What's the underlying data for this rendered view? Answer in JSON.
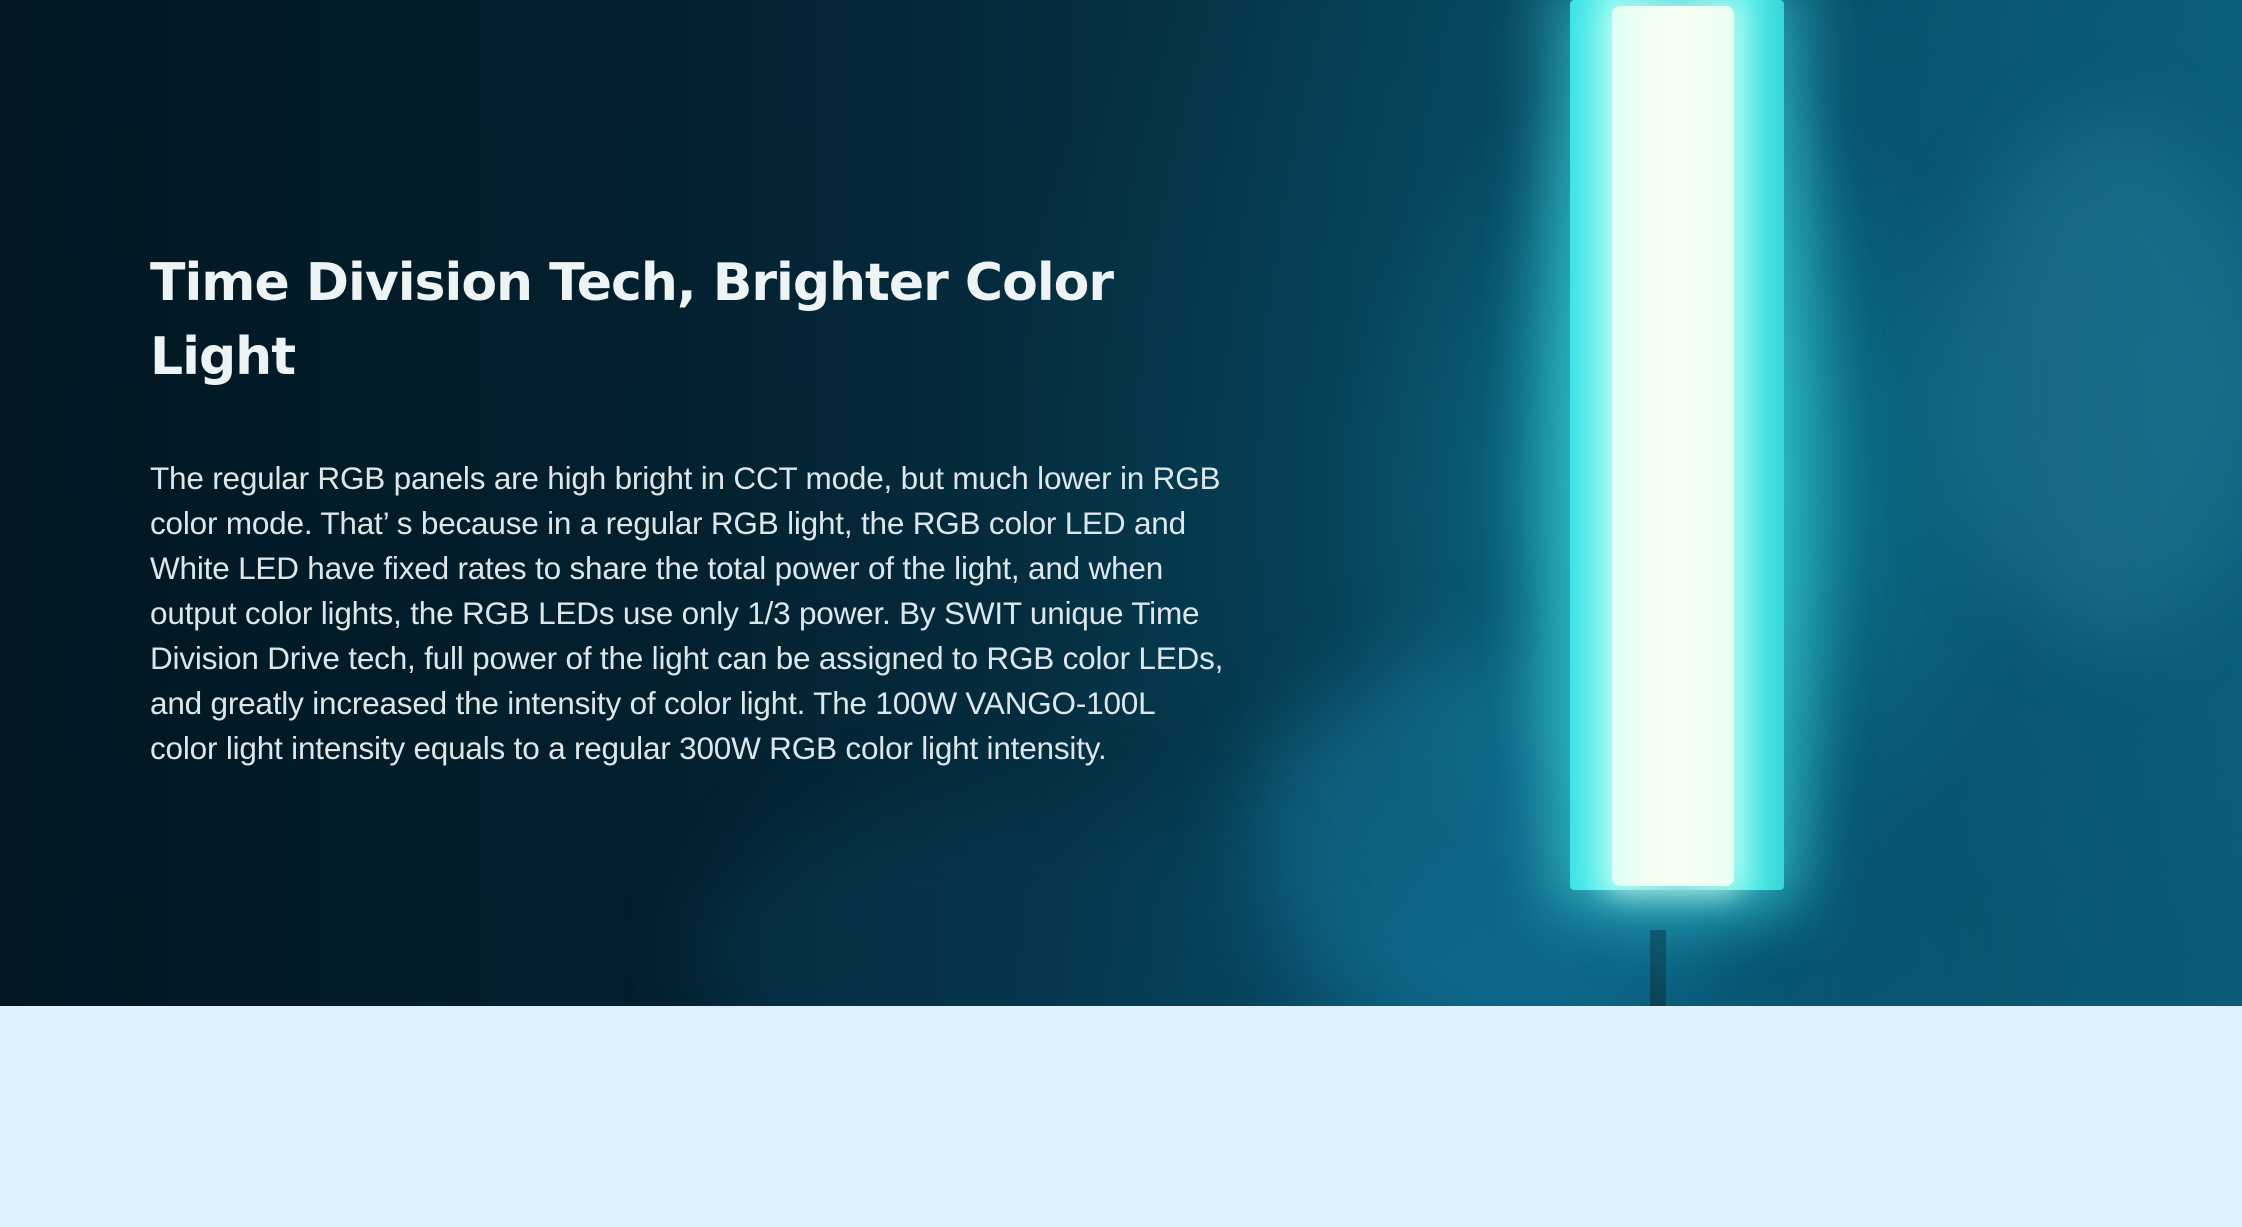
{
  "hero": {
    "headline": "Time Division Tech, Brighter Color Light",
    "body": "The regular RGB panels are high bright in CCT mode, but much lower in RGB color mode. That’ s because in a regular RGB light, the RGB color LED and White LED have fixed rates to share the total power of the light, and when output color lights, the RGB LEDs use only 1/3 power. By SWIT unique Time Division Drive tech, full power of the light can be assigned to RGB color LEDs, and greatly increased the intensity of color light. The 100W VANGO-100L color light intensity equals to a regular 300W RGB color light intensity.",
    "background_image": "cyan-tube-light-in-smoke"
  },
  "colors": {
    "hero_dark": "#021722",
    "lamp_cyan": "#3fe3e6",
    "headline_text": "#eef3f4",
    "body_text": "#dde6e9",
    "lower_section_bg": "#dff1ff"
  }
}
